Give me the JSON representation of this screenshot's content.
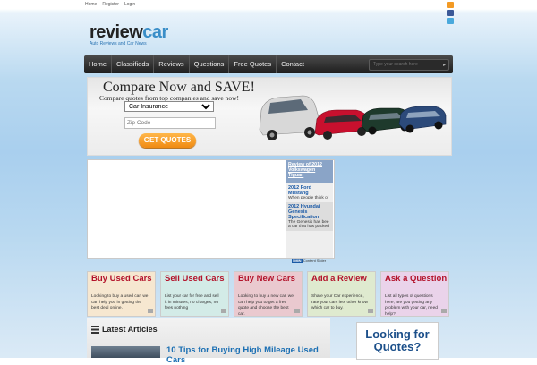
{
  "toplinks": [
    "Home",
    "Register",
    "Login"
  ],
  "logo": {
    "brand_a": "review",
    "brand_b": "car",
    "tagline": "Auto Reviews and Car News"
  },
  "nav": {
    "items": [
      "Home",
      "Classifieds",
      "Reviews",
      "Questions",
      "Free Quotes",
      "Contact"
    ],
    "search_placeholder": "Type your search here"
  },
  "banner": {
    "title": "Compare Now and SAVE!",
    "subtitle": "Compare quotes from top companies and save now!",
    "select_value": "Car Insurance",
    "zip_placeholder": "Zip Code",
    "button": "GET QUOTES"
  },
  "video_panel": {
    "reviews": [
      {
        "title": "Review of 2012 Volkswagen Tiguan",
        "desc": ""
      },
      {
        "title": "2012 Ford Mustang",
        "desc": "When people think of"
      },
      {
        "title": "2012 Hyundai Genesis Specification",
        "desc": "The Genesis has bee a car that has packed"
      }
    ],
    "powered_badge": "5MIN",
    "powered_text": "Content Slider"
  },
  "features": [
    {
      "title": "Buy Used Cars",
      "desc": "Looking to buy a used car, we can help you in getting the best deal online.",
      "bg": "#f6e7d0"
    },
    {
      "title": "Sell Used Cars",
      "desc": "List your car for free and sell it in minutes, no charges, no fees nothing",
      "bg": "#d3ebe7"
    },
    {
      "title": "Buy New Cars",
      "desc": "Looking to buy a new car, we can help you to get a free quote and choose the best car.",
      "bg": "#eac9cf"
    },
    {
      "title": "Add a Review",
      "desc": "Share your Car experience, rate your cars lets other know which car to buy.",
      "bg": "#dfeacf"
    },
    {
      "title": "Ask a Question",
      "desc": "List all types of questions here, are you getting any problem with your car, need help?",
      "bg": "#ead3ea"
    }
  ],
  "latest": {
    "heading": "Latest Articles",
    "article_title": "10 Tips for Buying High Mileage Used Cars"
  },
  "quotes_box": {
    "line1": "Looking for",
    "line2": "Quotes?"
  },
  "colors": {
    "accent_blue": "#3a8ec8",
    "headline_red": "#b3122a",
    "button_orange": "#f08a12"
  }
}
